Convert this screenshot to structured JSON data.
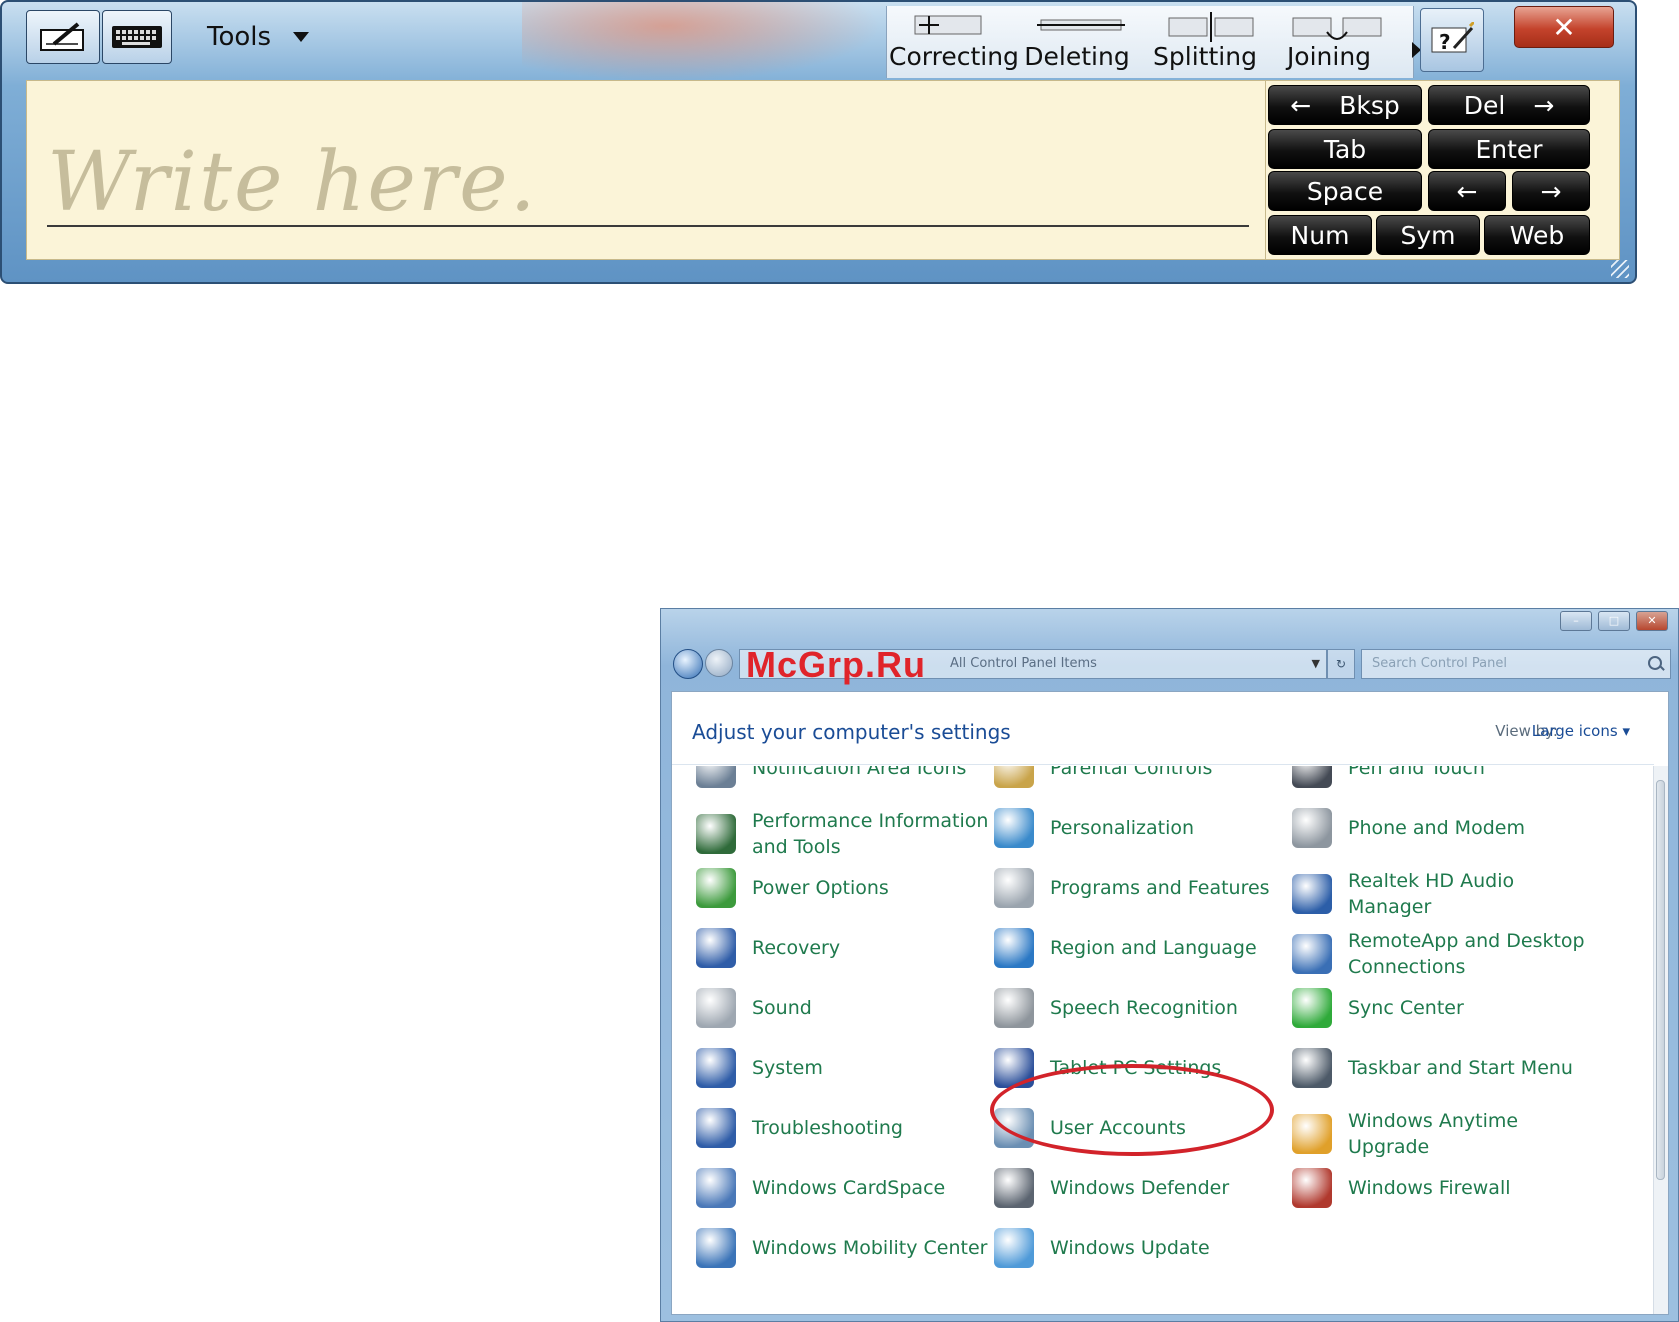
{
  "input_panel": {
    "tools_label": "Tools",
    "gestures": [
      {
        "label": "Correcting"
      },
      {
        "label": "Deleting"
      },
      {
        "label": "Splitting"
      },
      {
        "label": "Joining"
      }
    ],
    "write_hint": "Write here.",
    "keys": {
      "bksp": "Bksp",
      "del": "Del",
      "tab": "Tab",
      "enter": "Enter",
      "space": "Space",
      "num": "Num",
      "sym": "Sym",
      "web": "Web",
      "left_arrow": "←",
      "right_arrow": "→"
    }
  },
  "watermark": "McGrp.Ru",
  "control_panel": {
    "address": "All Control Panel Items",
    "search_placeholder": "Search Control Panel",
    "heading": "Adjust your computer's settings",
    "view_by_label": "View by:",
    "view_by_value": "Large icons",
    "items": [
      {
        "label": "Notification Area Icons",
        "icon": "notification-area-icon",
        "color": "#6b7f95"
      },
      {
        "label": "Parental Controls",
        "icon": "parental-controls-icon",
        "color": "#c9a44a"
      },
      {
        "label": "Pen and Touch",
        "icon": "pen-icon",
        "color": "#444a55"
      },
      {
        "label": "Performance Information and Tools",
        "icon": "performance-icon",
        "color": "#2f6b3a"
      },
      {
        "label": "Personalization",
        "icon": "personalization-icon",
        "color": "#3a8acb"
      },
      {
        "label": "Phone and Modem",
        "icon": "phone-modem-icon",
        "color": "#8d969f"
      },
      {
        "label": "Power Options",
        "icon": "power-options-icon",
        "color": "#3c9a3c"
      },
      {
        "label": "Programs and Features",
        "icon": "programs-features-icon",
        "color": "#9aa4ae"
      },
      {
        "label": "Realtek HD Audio Manager",
        "icon": "realtek-audio-icon",
        "color": "#2c5ea8"
      },
      {
        "label": "Recovery",
        "icon": "recovery-icon",
        "color": "#2f5da8"
      },
      {
        "label": "Region and Language",
        "icon": "region-language-icon",
        "color": "#2b78c4"
      },
      {
        "label": "RemoteApp and Desktop Connections",
        "icon": "remoteapp-icon",
        "color": "#3a6fb5"
      },
      {
        "label": "Sound",
        "icon": "sound-icon",
        "color": "#9ea7b1"
      },
      {
        "label": "Speech Recognition",
        "icon": "microphone-icon",
        "color": "#8e959c"
      },
      {
        "label": "Sync Center",
        "icon": "sync-center-icon",
        "color": "#2faa3a"
      },
      {
        "label": "System",
        "icon": "system-icon",
        "color": "#2f5da8"
      },
      {
        "label": "Tablet PC Settings",
        "icon": "tablet-pc-icon",
        "color": "#2b4f9a"
      },
      {
        "label": "Taskbar and Start Menu",
        "icon": "taskbar-icon",
        "color": "#4d5a68"
      },
      {
        "label": "Troubleshooting",
        "icon": "troubleshooting-icon",
        "color": "#2f5da8"
      },
      {
        "label": "User Accounts",
        "icon": "user-accounts-icon",
        "color": "#6b8fb3"
      },
      {
        "label": "Windows Anytime Upgrade",
        "icon": "windows-logo-icon",
        "color": "#e0a02a"
      },
      {
        "label": "Windows CardSpace",
        "icon": "cardspace-icon",
        "color": "#4a78b8"
      },
      {
        "label": "Windows Defender",
        "icon": "defender-icon",
        "color": "#5b6470"
      },
      {
        "label": "Windows Firewall",
        "icon": "firewall-icon",
        "color": "#b0392e"
      },
      {
        "label": "Windows Mobility Center",
        "icon": "mobility-center-icon",
        "color": "#3b74b8"
      },
      {
        "label": "Windows Update",
        "icon": "windows-update-icon",
        "color": "#4f9ad8"
      }
    ]
  }
}
